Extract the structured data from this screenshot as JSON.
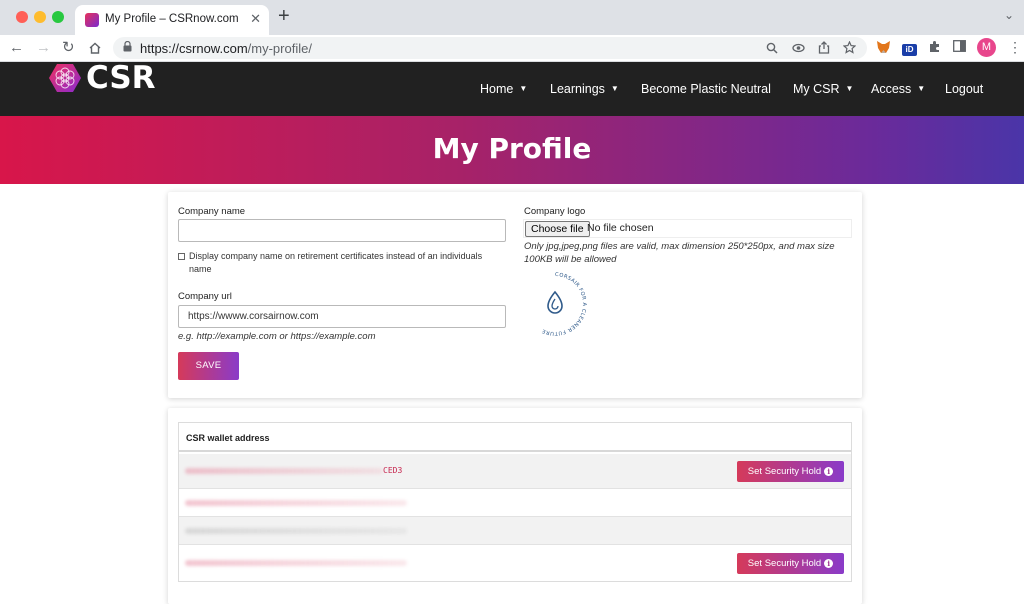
{
  "browser": {
    "tab_title": "My Profile – CSRnow.com",
    "tab_close": "✕",
    "new_tab": "+",
    "url_base": "https://csrnow.com",
    "url_path": "/my-profile/",
    "profile_initial": "M",
    "icons": [
      "search-icon",
      "eye-icon",
      "share-icon",
      "star-icon",
      "metamask-icon",
      "id-extension-icon",
      "puzzle-icon",
      "sidepanel-icon"
    ]
  },
  "site": {
    "logo_text": "CSR",
    "nav": [
      {
        "label": "Home",
        "dropdown": true
      },
      {
        "label": "Learnings",
        "dropdown": true
      },
      {
        "label": "Become Plastic Neutral",
        "dropdown": false
      },
      {
        "label": "My CSR",
        "dropdown": true
      },
      {
        "label": "Access",
        "dropdown": true
      },
      {
        "label": "Logout",
        "dropdown": false
      }
    ],
    "page_title": "My Profile"
  },
  "profile_form": {
    "company_name_label": "Company name",
    "company_name_value": "",
    "display_checkbox_label_line1": "Display company name on retirement certificates instead of an individuals",
    "display_checkbox_label_line2": "name",
    "display_checkbox_checked": false,
    "company_url_label": "Company url",
    "company_url_value": "https://wwww.corsairnow.com",
    "company_url_help": "e.g. http://example.com or https://example.com",
    "save_label": "SAVE",
    "company_logo_label": "Company logo",
    "file_button_label": "Choose file",
    "file_status": "No file chosen",
    "logo_help_line1": "Only jpg,jpeg,png files are valid, max dimension 250*250px, and max size",
    "logo_help_line2": "100KB will be allowed",
    "seal_text": "CORSAIR FOR A CLEANER FUTURE"
  },
  "wallet": {
    "header": "CSR wallet address",
    "rows": [
      {
        "visible_suffix": "CED3",
        "hold_button": true
      },
      {
        "visible_suffix": "",
        "hold_button": false
      },
      {
        "visible_suffix": "",
        "hold_button": false
      },
      {
        "visible_suffix": "",
        "hold_button": true
      }
    ],
    "hold_label": "Set Security Hold",
    "info_glyph": "i"
  },
  "colors": {
    "nav_bg": "#212121",
    "banner_start": "#d8164a",
    "banner_end": "#4a35a8",
    "button_start": "#d53a5a",
    "button_end": "#8a3bc9",
    "address_color": "#c7254e"
  }
}
